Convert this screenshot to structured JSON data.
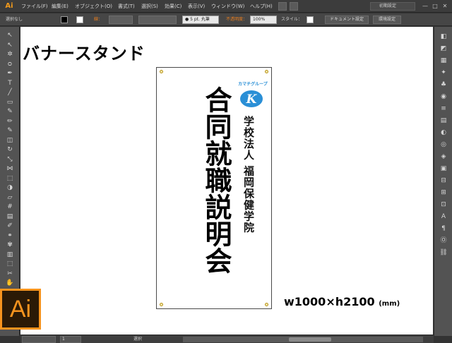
{
  "menubar": {
    "app_badge": "Ai",
    "items": [
      "ファイル(F)",
      "編集(E)",
      "オブジェクト(O)",
      "書式(T)",
      "選択(S)",
      "効果(C)",
      "表示(V)",
      "ウィンドウ(W)",
      "ヘルプ(H)"
    ],
    "workspace": "初期設定",
    "window_buttons": [
      "—",
      "□",
      "✕"
    ]
  },
  "controlbar": {
    "selection_label": "選択なし",
    "stroke_label": "線：",
    "stroke_width_placeholder": "",
    "brush": "● 5 pt. 丸筆",
    "opacity_label": "不透明度：",
    "opacity_value": "100%",
    "style_label": "スタイル：",
    "doc_settings": "ドキュメント設定",
    "env_settings": "環境設定",
    "colors": {
      "fill": "#000000",
      "stroke_none": "#ffffff",
      "accent_orange": "#e87d1e"
    }
  },
  "tools": {
    "icons": [
      "selection-icon",
      "direct-selection-icon",
      "magic-wand-icon",
      "lasso-icon",
      "pen-icon",
      "type-icon",
      "line-icon",
      "rectangle-icon",
      "paintbrush-icon",
      "pencil-icon",
      "blob-brush-icon",
      "eraser-icon",
      "rotate-icon",
      "scale-icon",
      "width-icon",
      "free-transform-icon",
      "shape-builder-icon",
      "perspective-icon",
      "mesh-icon",
      "gradient-icon",
      "eyedropper-icon",
      "blend-icon",
      "symbol-sprayer-icon",
      "column-graph-icon",
      "artboard-icon",
      "slice-icon",
      "hand-icon",
      "zoom-icon"
    ],
    "glyphs": [
      "↖",
      "↖",
      "✲",
      "ᴑ",
      "✒",
      "T",
      "╱",
      "▭",
      "✎",
      "✏",
      "✎",
      "◫",
      "↻",
      "⤡",
      "⋈",
      "⬚",
      "◑",
      "▱",
      "#",
      "▤",
      "✐",
      "⚭",
      "✾",
      "▥",
      "⬚",
      "✂",
      "✋",
      "⌕"
    ]
  },
  "panels": {
    "icons": [
      "color-panel-icon",
      "color-guide-icon",
      "swatches-icon",
      "brushes-icon",
      "symbols-icon",
      "graphic-styles-icon",
      "stroke-panel-icon",
      "gradient-panel-icon",
      "transparency-icon",
      "appearance-icon",
      "layers-icon",
      "artboards-icon",
      "align-icon",
      "pathfinder-icon",
      "transform-icon",
      "character-icon",
      "paragraph-icon",
      "opentype-icon",
      "links-icon"
    ],
    "glyphs": [
      "◧",
      "◩",
      "▦",
      "✦",
      "♣",
      "◉",
      "≡",
      "▤",
      "◐",
      "◎",
      "◈",
      "▣",
      "⊟",
      "⊞",
      "⊡",
      "A",
      "¶",
      "Ⓞ",
      "⛓"
    ]
  },
  "document": {
    "title": "バナースタンド",
    "banner": {
      "logo_text": "カマチグループ",
      "logo_letter": "K",
      "main_text": "合同就職説明会",
      "sub_text": "学校法人 福岡保健学院",
      "logo_color": "#2a8fd6"
    },
    "size_main": "w1000×h2100",
    "size_unit": "(mm)"
  },
  "overlay": {
    "logo_text": "Ai",
    "logo_color": "#f7941e"
  },
  "statusbar": {
    "zoom": "",
    "page": "1",
    "tool_name": "選択"
  }
}
